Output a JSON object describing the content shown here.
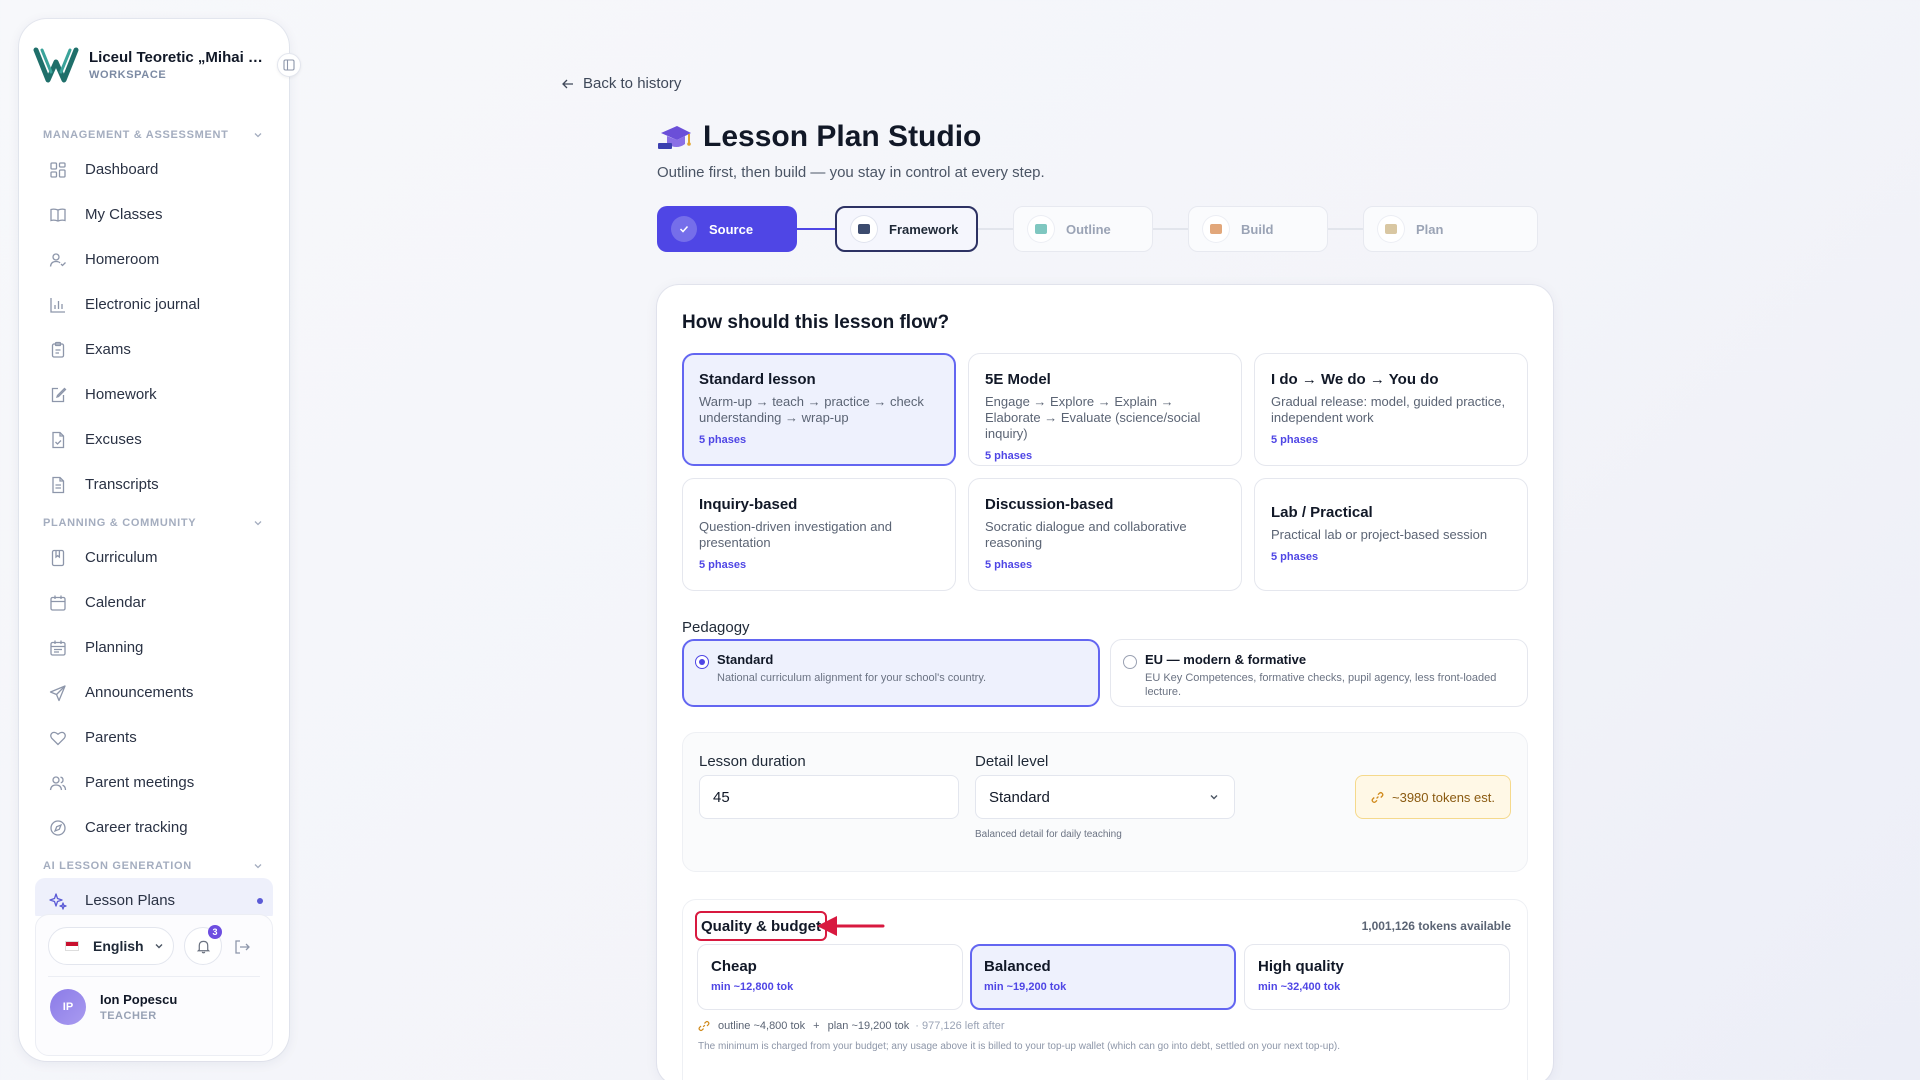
{
  "workspace": {
    "name": "Liceul Teoretic „Mihai Emi...",
    "subtitle": "WORKSPACE"
  },
  "sidebar": {
    "sections": [
      {
        "title": "MANAGEMENT & ASSESSMENT",
        "items": [
          {
            "label": "Dashboard",
            "icon": "grid-icon"
          },
          {
            "label": "My Classes",
            "icon": "book-icon"
          },
          {
            "label": "Homeroom",
            "icon": "user-check-icon"
          },
          {
            "label": "Electronic journal",
            "icon": "bar-chart-icon"
          },
          {
            "label": "Exams",
            "icon": "clipboard-icon"
          },
          {
            "label": "Homework",
            "icon": "edit-note-icon"
          },
          {
            "label": "Excuses",
            "icon": "file-check-icon"
          },
          {
            "label": "Transcripts",
            "icon": "file-text-icon"
          }
        ]
      },
      {
        "title": "PLANNING & COMMUNITY",
        "items": [
          {
            "label": "Curriculum",
            "icon": "bookmark-book-icon"
          },
          {
            "label": "Calendar",
            "icon": "calendar-icon"
          },
          {
            "label": "Planning",
            "icon": "calendar-list-icon"
          },
          {
            "label": "Announcements",
            "icon": "send-icon"
          },
          {
            "label": "Parents",
            "icon": "heart-icon"
          },
          {
            "label": "Parent meetings",
            "icon": "users-icon"
          },
          {
            "label": "Career tracking",
            "icon": "compass-icon"
          }
        ]
      },
      {
        "title": "AI LESSON GENERATION",
        "items": [
          {
            "label": "Lesson Plans",
            "icon": "sparkles-icon",
            "active": true
          }
        ]
      }
    ],
    "footer": {
      "language": "English",
      "notifications_count": "3",
      "user_initials": "IP",
      "user_name": "Ion Popescu",
      "user_role": "TEACHER"
    }
  },
  "main": {
    "back_label": "Back to history",
    "title": "Lesson Plan Studio",
    "subtitle": "Outline first, then build — you stay in control at every step.",
    "steps": [
      {
        "label": "Source",
        "state": "done"
      },
      {
        "label": "Framework",
        "state": "current"
      },
      {
        "label": "Outline",
        "state": "todo"
      },
      {
        "label": "Build",
        "state": "todo"
      },
      {
        "label": "Plan",
        "state": "todo"
      }
    ],
    "flow_question": "How should this lesson flow?",
    "frameworks": [
      {
        "title": "Standard lesson",
        "desc": "Warm-up → teach → practice → check understanding → wrap-up",
        "phases": "5 phases",
        "selected": true
      },
      {
        "title": "5E Model",
        "desc": "Engage → Explore → Explain → Elaborate → Evaluate (science/social inquiry)",
        "phases": "5 phases"
      },
      {
        "title": "I do → We do → You do",
        "desc": "Gradual release: model, guided practice, independent work",
        "phases": "5 phases"
      },
      {
        "title": "Inquiry-based",
        "desc": "Question-driven investigation and presentation",
        "phases": "5 phases"
      },
      {
        "title": "Discussion-based",
        "desc": "Socratic dialogue and collaborative reasoning",
        "phases": "5 phases"
      },
      {
        "title": "Lab / Practical",
        "desc": "Practical lab or project-based session",
        "phases": "5 phases"
      }
    ],
    "pedagogy": {
      "label": "Pedagogy",
      "options": [
        {
          "title": "Standard",
          "desc": "National curriculum alignment for your school's country.",
          "selected": true
        },
        {
          "title": "EU — modern & formative",
          "desc": "EU Key Competences, formative checks, pupil agency, less front-loaded lecture."
        }
      ]
    },
    "options": {
      "duration_label": "Lesson duration",
      "duration_value": "45",
      "detail_label": "Detail level",
      "detail_value": "Standard",
      "detail_help": "Balanced detail for daily teaching",
      "tokens_estimate": "~3980 tokens est."
    },
    "quality": {
      "title": "Quality & budget",
      "available": "1,001,126 tokens available",
      "tiers": [
        {
          "name": "Cheap",
          "min": "min ~12,800 tok"
        },
        {
          "name": "Balanced",
          "min": "min ~19,200 tok",
          "selected": true
        },
        {
          "name": "High quality",
          "min": "min ~32,400 tok"
        }
      ],
      "breakdown_outline": "outline ~4,800 tok",
      "breakdown_plus": "+",
      "breakdown_plan": "plan ~19,200 tok",
      "breakdown_left": "· 977,126 left after",
      "note": "The minimum is charged from your budget; any usage above it is billed to your top-up wallet (which can go into debt, settled on your next top-up)."
    }
  },
  "colors": {
    "accent": "#4f46e5",
    "accent_light": "#eef1fd",
    "highlight_red": "#d8193f",
    "brand_teal": "#1f6f6a"
  }
}
